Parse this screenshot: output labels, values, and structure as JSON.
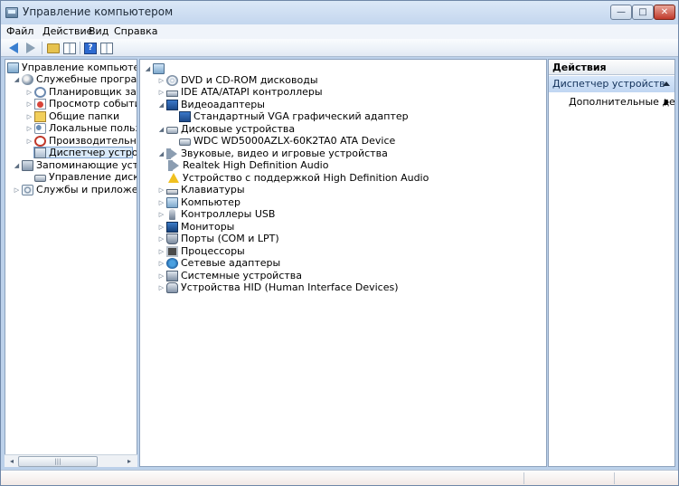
{
  "window": {
    "title": "Управление компьютером",
    "controls": {
      "minimize": "—",
      "maximize": "□",
      "close": "✕"
    }
  },
  "menu": [
    "Файл",
    "Действие",
    "Вид",
    "Справка"
  ],
  "toolbar": {
    "back_icon": "back-arrow-icon",
    "forward_icon": "forward-arrow-icon",
    "help_glyph": "?"
  },
  "left_tree": [
    {
      "label": "Управление компьютером (л",
      "icon": "computer-management-icon",
      "toggle": ""
    },
    {
      "label": "Служебные программы",
      "icon": "tools-icon",
      "toggle": "◢"
    },
    {
      "label": "Планировщик заданий",
      "icon": "clock-icon",
      "toggle": "▷"
    },
    {
      "label": "Просмотр событий",
      "icon": "event-viewer-icon",
      "toggle": "▷"
    },
    {
      "label": "Общие папки",
      "icon": "shared-folders-icon",
      "toggle": "▷"
    },
    {
      "label": "Локальные пользовате",
      "icon": "users-icon",
      "toggle": "▷"
    },
    {
      "label": "Производительность",
      "icon": "performance-icon",
      "toggle": "▷"
    },
    {
      "label": "Диспетчер устройств",
      "icon": "device-manager-icon",
      "toggle": ""
    },
    {
      "label": "Запоминающие устройст",
      "icon": "storage-icon",
      "toggle": "◢"
    },
    {
      "label": "Управление дисками",
      "icon": "disk-management-icon",
      "toggle": ""
    },
    {
      "label": "Службы и приложения",
      "icon": "services-icon",
      "toggle": "▷"
    }
  ],
  "left_scroll": {
    "left": "◂",
    "right": "▸",
    "thumb": "|||"
  },
  "device_tree": {
    "root_toggle": "◢",
    "items": [
      {
        "label": "DVD и CD-ROM дисководы",
        "icon": "dvd-icon",
        "toggle": "▷",
        "level": 1
      },
      {
        "label": "IDE ATA/ATAPI контроллеры",
        "icon": "ide-controller-icon",
        "toggle": "▷",
        "level": 1
      },
      {
        "label": "Видеоадаптеры",
        "icon": "display-adapter-icon",
        "toggle": "◢",
        "level": 1
      },
      {
        "label": "Стандартный VGA графический адаптер",
        "icon": "display-adapter-icon",
        "toggle": "",
        "level": 2
      },
      {
        "label": "Дисковые устройства",
        "icon": "disk-drive-icon",
        "toggle": "◢",
        "level": 1
      },
      {
        "label": "WDC WD5000AZLX-60K2TA0 ATA Device",
        "icon": "disk-drive-icon",
        "toggle": "",
        "level": 2
      },
      {
        "label": "Звуковые, видео и игровые устройства",
        "icon": "sound-icon",
        "toggle": "◢",
        "level": 1
      },
      {
        "label": "Realtek High Definition Audio",
        "icon": "sound-icon",
        "toggle": "",
        "level": 2
      },
      {
        "label": "Устройство с поддержкой High Definition Audio",
        "icon": "warning-device-icon",
        "toggle": "",
        "level": 2
      },
      {
        "label": "Клавиатуры",
        "icon": "keyboard-icon",
        "toggle": "▷",
        "level": 1
      },
      {
        "label": "Компьютер",
        "icon": "computer-icon",
        "toggle": "▷",
        "level": 1
      },
      {
        "label": "Контроллеры USB",
        "icon": "usb-icon",
        "toggle": "▷",
        "level": 1
      },
      {
        "label": "Мониторы",
        "icon": "monitor-icon",
        "toggle": "▷",
        "level": 1
      },
      {
        "label": "Порты (COM и LPT)",
        "icon": "port-icon",
        "toggle": "▷",
        "level": 1
      },
      {
        "label": "Процессоры",
        "icon": "processor-icon",
        "toggle": "▷",
        "level": 1
      },
      {
        "label": "Сетевые адаптеры",
        "icon": "network-adapter-icon",
        "toggle": "▷",
        "level": 1
      },
      {
        "label": "Системные устройства",
        "icon": "system-device-icon",
        "toggle": "▷",
        "level": 1
      },
      {
        "label": "Устройства HID (Human Interface Devices)",
        "icon": "hid-icon",
        "toggle": "▷",
        "level": 1
      }
    ]
  },
  "actions": {
    "header": "Действия",
    "section": "Диспетчер устройств",
    "items": [
      "Дополнительные дей..."
    ]
  }
}
